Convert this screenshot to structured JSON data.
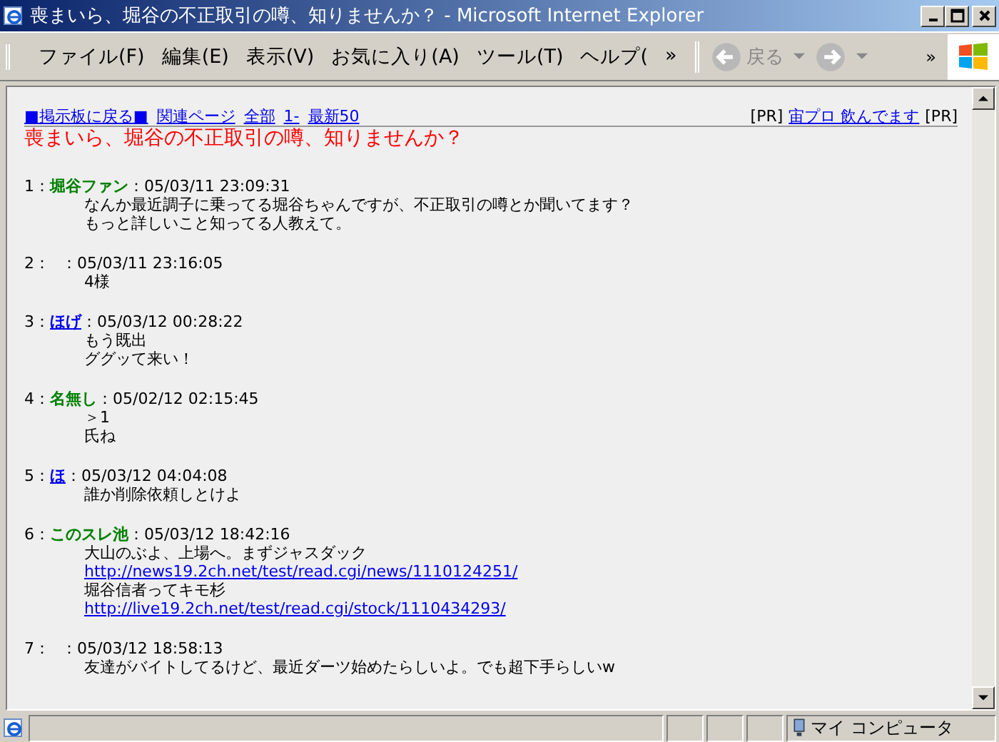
{
  "window": {
    "title": "喪まいら、堀谷の不正取引の噂、知りませんか？ - Microsoft Internet Explorer"
  },
  "menu": [
    "ファイル(F)",
    "編集(E)",
    "表示(V)",
    "お気に入り(A)",
    "ツール(T)",
    "ヘルプ(",
    "»"
  ],
  "toolbar": {
    "back": "戻る",
    "more": "»"
  },
  "nav_links": [
    "■掲示板に戻る■",
    "関連ページ",
    "全部",
    "1-",
    "最新50"
  ],
  "pr": {
    "prefix": "[PR]",
    "link": "宙プロ 飲んでます",
    "suffix": "[PR]"
  },
  "thread_title": "喪まいら、堀谷の不正取引の噂、知りませんか？",
  "posts": [
    {
      "number": "1：",
      "name_is_link": false,
      "name": "堀谷ファン",
      "date": "：05/03/11 23:09:31",
      "lines": [
        {
          "kind": "text",
          "text": "なんか最近調子に乗ってる堀谷ちゃんですが、不正取引の噂とか聞いてます？"
        },
        {
          "kind": "text",
          "text": "もっと詳しいこと知ってる人教えて。"
        }
      ]
    },
    {
      "number": "2：",
      "date": "：05/03/11 23:16:05",
      "lines": [
        {
          "kind": "text",
          "text": "4様"
        }
      ]
    },
    {
      "number": "3：",
      "name_is_link": true,
      "name": "ほげ",
      "date": "：05/03/12 00:28:22",
      "lines": [
        {
          "kind": "text",
          "text": "もう既出"
        },
        {
          "kind": "text",
          "text": "ググッて来い！"
        }
      ]
    },
    {
      "number": "4：",
      "name_is_link": false,
      "name": "名無し",
      "date": "：05/02/12 02:15:45",
      "lines": [
        {
          "kind": "text",
          "text": "＞1"
        },
        {
          "kind": "text",
          "text": "氏ね"
        }
      ]
    },
    {
      "number": "5：",
      "name_is_link": true,
      "name": "ほ",
      "date": "：05/03/12 04:04:08",
      "lines": [
        {
          "kind": "text",
          "text": "誰か削除依頼しとけよ"
        }
      ]
    },
    {
      "number": "6：",
      "name_is_link": false,
      "name": "このスレ池",
      "date": "：05/03/12 18:42:16",
      "lines": [
        {
          "kind": "text",
          "text": "大山のぶよ、上場へ。まずジャスダック"
        },
        {
          "kind": "link",
          "text": "http://news19.2ch.net/test/read.cgi/news/1110124251/"
        },
        {
          "kind": "text",
          "text": "堀谷信者ってキモ杉"
        },
        {
          "kind": "link",
          "text": "http://live19.2ch.net/test/read.cgi/stock/1110434293/"
        }
      ]
    },
    {
      "number": "7：",
      "date": "：05/03/12 18:58:13",
      "lines": [
        {
          "kind": "text",
          "text": "友達がバイトしてるけど、最近ダーツ始めたらしいよ。でも超下手らしいw"
        }
      ]
    }
  ],
  "status_bar": {
    "zone": "マイ コンピュータ"
  }
}
